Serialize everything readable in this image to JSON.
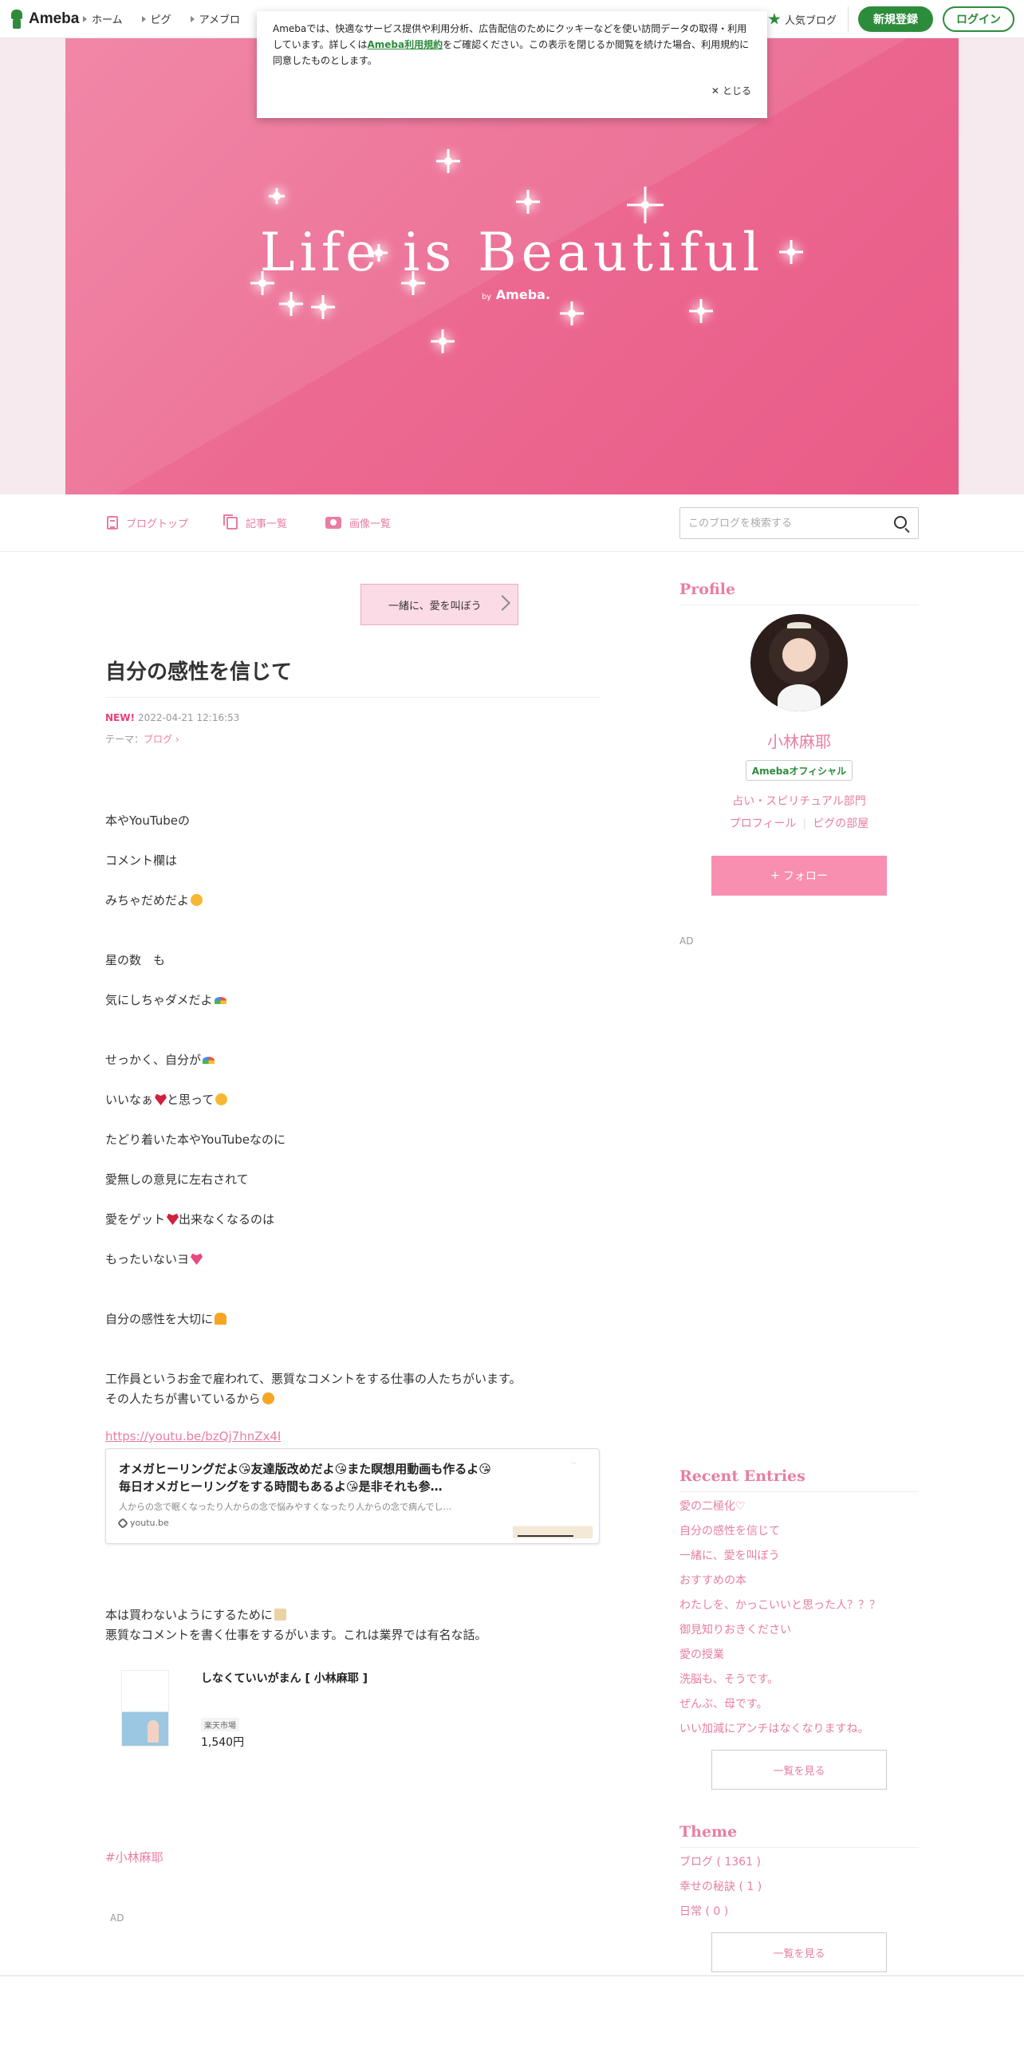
{
  "global_header": {
    "logo": "Ameba",
    "nav": [
      "ホーム",
      "ピグ",
      "アメブロ"
    ],
    "popular_label": "人気ブログ",
    "register_label": "新規登録",
    "login_label": "ログイン"
  },
  "cookie": {
    "text_before": "Amebaでは、快適なサービス提供や利用分析、広告配信のためにクッキーなどを使い訪問データの取得・利用しています。詳しくは",
    "link": "Ameba利用規約",
    "text_after": "をご確認ください。この表示を閉じるか閲覧を続けた場合、利用規約に同意したものとします。",
    "close_label": "とじる"
  },
  "hero": {
    "title": "Life is Beautiful",
    "by": "by",
    "brand": "Ameba."
  },
  "blog_nav": {
    "items": [
      "ブログトップ",
      "記事一覧",
      "画像一覧"
    ],
    "search_placeholder": "このブログを検索する"
  },
  "article": {
    "ai_banner": "一緒に、愛を叫ぼう",
    "title": "自分の感性を信じて",
    "new_badge": "NEW!",
    "datetime": "2022-04-21 12:16:53",
    "theme_prefix": "テーマ：",
    "theme": "ブログ",
    "lines": [
      "本やYouTubeの",
      "コメント欄は",
      "みちゃだめだよ",
      "星の数　も",
      "気にしちゃダメだよ",
      "せっかく、自分が",
      "いいなぁ",
      "と思って",
      "たどり着いた本やYouTubeなのに",
      "愛無しの意見に左右されて",
      "愛をゲット",
      "出来なくなるのは",
      "もったいないヨ",
      "自分の感性を大切に",
      "工作員というお金で雇われて、悪質なコメントをする仕事の人たちがいます。",
      "その人たちが書いているから",
      "本は買わないようにするために",
      "悪質なコメントを書く仕事をするがいます。これは業界では有名な話。"
    ],
    "youtube_url": "https://youtu.be/bzQj7hnZx4I",
    "ogp_title": "オメガヒーリングだよ😘友達版改めだよ😘また瞑想用動画も作るよ😘毎日オメガヒーリングをする時間もあるよ😘是非それも参…",
    "ogp_desc": "人からの念で眠くなったり人からの念で悩みやすくなったり人からの念で病んでし…",
    "ogp_domain": "youtu.be",
    "product_name": "しなくていいがまん [ 小林麻耶 ]",
    "product_shop": "楽天市場",
    "product_price": "1,540円",
    "hashtag": "#小林麻耶",
    "ad_label": "AD"
  },
  "sidebar": {
    "profile_heading": "Profile",
    "name": "小林麻耶",
    "official_badge": "Amebaオフィシャル",
    "category": "占い・スピリチュアル部門",
    "profile_link": "プロフィール",
    "pig_link": "ピグの部屋",
    "follow_label": "フォロー",
    "ad_label": "AD",
    "recent_heading": "Recent Entries",
    "recent_entries": [
      "愛の二極化♡",
      "自分の感性を信じて",
      "一緒に、愛を叫ぼう",
      "おすすめの本",
      "わたしを、かっこいいと思った人？？？",
      "御見知りおきください",
      "愛の授業",
      "洗脳も、そうです。",
      "ぜんぶ、母です。",
      "いい加減にアンチはなくなりますね。"
    ],
    "more_label": "一覧を見る",
    "theme_heading": "Theme",
    "themes": [
      "ブログ ( 1361 )",
      "幸せの秘訣 ( 1 )",
      "日常 ( 0 )"
    ]
  }
}
